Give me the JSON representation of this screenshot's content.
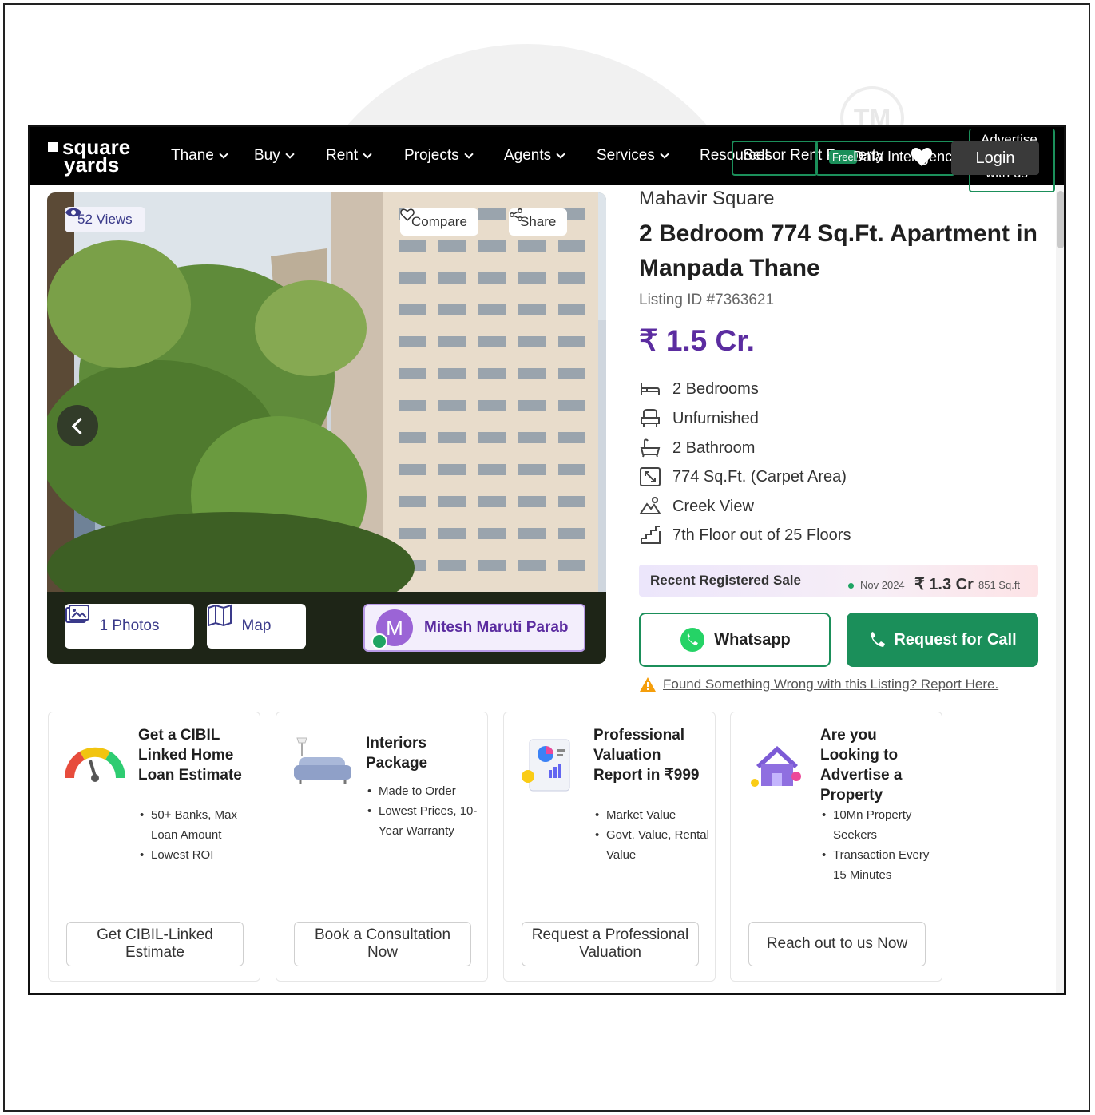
{
  "nav": {
    "logo_line1": "square",
    "logo_line2": "yards",
    "items": [
      {
        "label": "Thane"
      },
      {
        "label": "Buy"
      },
      {
        "label": "Rent"
      },
      {
        "label": "Projects"
      },
      {
        "label": "Agents"
      },
      {
        "label": "Services"
      },
      {
        "label": "Resources"
      }
    ],
    "sell_or_rent": "Sell or Rent Property",
    "free_badge": "Free",
    "data_intelligence": "Data Intelligence",
    "advertise_line1": "Advertise",
    "advertise_line2": "with us",
    "login": "Login"
  },
  "gallery": {
    "views": "52 Views",
    "compare": "Compare",
    "share": "Share",
    "photos": "1 Photos",
    "map": "Map",
    "agent_initial": "M",
    "agent_name": "Mitesh Maruti Parab"
  },
  "listing": {
    "project": "Mahavir Square",
    "title": "2 Bedroom 774 Sq.Ft. Apartment in Manpada Thane",
    "listing_id": "Listing ID #7363621",
    "price": "₹ 1.5 Cr.",
    "features": [
      {
        "icon": "bed-icon",
        "label": "2 Bedrooms"
      },
      {
        "icon": "armchair-icon",
        "label": "Unfurnished"
      },
      {
        "icon": "bathtub-icon",
        "label": "2 Bathroom"
      },
      {
        "icon": "area-icon",
        "label": "774 Sq.Ft. (Carpet Area)"
      },
      {
        "icon": "view-icon",
        "label": "Creek View"
      },
      {
        "icon": "floor-icon",
        "label": "7th Floor out of 25 Floors"
      }
    ],
    "recent_sale": {
      "label": "Recent Registered Sale",
      "date": "Nov 2024",
      "price": "₹ 1.3 Cr",
      "area": "851 Sq.ft"
    },
    "whatsapp": "Whatsapp",
    "request_call": "Request for Call",
    "report": "Found Something Wrong with this Listing? Report Here."
  },
  "cards": [
    {
      "icon": "gauge-icon",
      "title": "Get a CIBIL Linked Home Loan Estimate",
      "bullets": [
        "50+ Banks, Max Loan Amount",
        "Lowest ROI"
      ],
      "cta": "Get CIBIL-Linked Estimate"
    },
    {
      "icon": "sofa-icon",
      "title": "Interiors Package",
      "bullets": [
        "Made to Order",
        "Lowest Prices, 10-Year Warranty"
      ],
      "cta": "Book a Consultation Now"
    },
    {
      "icon": "report-icon",
      "title": "Professional Valuation Report in ₹999",
      "bullets": [
        "Market Value",
        "Govt. Value, Rental Value"
      ],
      "cta": "Request a Professional Valuation"
    },
    {
      "icon": "house-icon",
      "title": "Are you Looking to Advertise a Property",
      "bullets": [
        "10Mn Property Seekers",
        "Transaction Every 15 Minutes"
      ],
      "cta": "Reach out to us Now"
    }
  ],
  "colors": {
    "brand_purple": "#5b2ca0",
    "whatsapp_green": "#1b8f5a",
    "nav_bg": "#000000"
  }
}
